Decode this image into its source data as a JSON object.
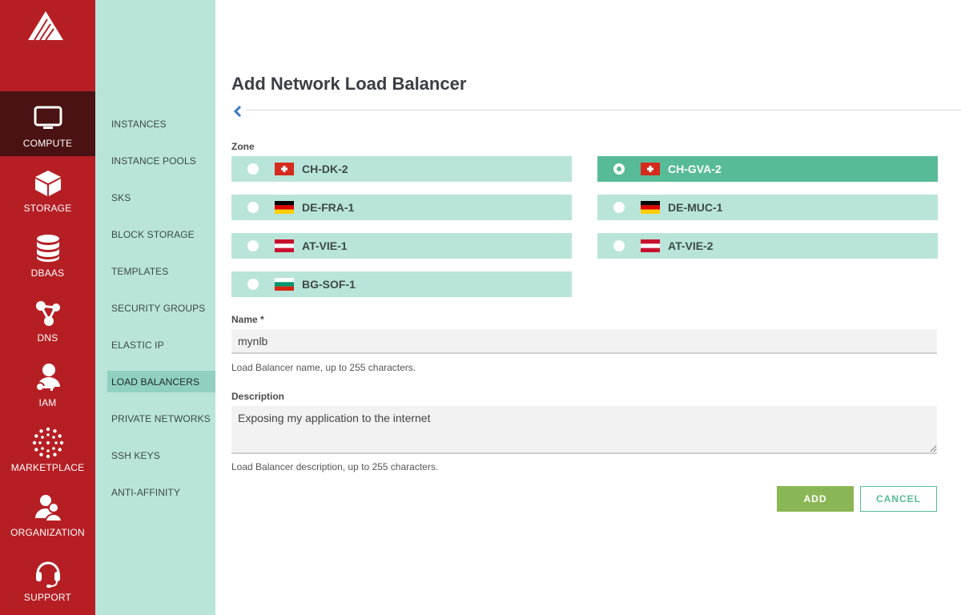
{
  "rail": {
    "logo_icon": "exoscale-logo",
    "items": [
      {
        "label": "COMPUTE",
        "icon": "monitor-icon",
        "active": true
      },
      {
        "label": "STORAGE",
        "icon": "cube-icon"
      },
      {
        "label": "DBAAS",
        "icon": "database-icon"
      },
      {
        "label": "DNS",
        "icon": "network-icon"
      },
      {
        "label": "IAM",
        "icon": "user-key-icon"
      },
      {
        "label": "MARKETPLACE",
        "icon": "dots-circle-icon"
      },
      {
        "label": "ORGANIZATION",
        "icon": "users-icon"
      },
      {
        "label": "SUPPORT",
        "icon": "headset-icon"
      }
    ]
  },
  "subnav": {
    "items": [
      {
        "label": "INSTANCES"
      },
      {
        "label": "INSTANCE POOLS"
      },
      {
        "label": "SKS"
      },
      {
        "label": "BLOCK STORAGE"
      },
      {
        "label": "TEMPLATES"
      },
      {
        "label": "SECURITY GROUPS"
      },
      {
        "label": "ELASTIC IP"
      },
      {
        "label": "LOAD BALANCERS",
        "active": true
      },
      {
        "label": "PRIVATE NETWORKS"
      },
      {
        "label": "SSH KEYS"
      },
      {
        "label": "ANTI-AFFINITY"
      }
    ]
  },
  "page": {
    "title": "Add Network Load Balancer",
    "back_icon": "chevron-left-icon"
  },
  "form": {
    "zone_label": "Zone",
    "zones": [
      {
        "name": "CH-DK-2",
        "flag": "switzerland",
        "selected": false
      },
      {
        "name": "CH-GVA-2",
        "flag": "switzerland",
        "selected": true
      },
      {
        "name": "DE-FRA-1",
        "flag": "germany",
        "selected": false
      },
      {
        "name": "DE-MUC-1",
        "flag": "germany",
        "selected": false
      },
      {
        "name": "AT-VIE-1",
        "flag": "austria",
        "selected": false
      },
      {
        "name": "AT-VIE-2",
        "flag": "austria",
        "selected": false
      },
      {
        "name": "BG-SOF-1",
        "flag": "bulgaria",
        "selected": false
      }
    ],
    "name_label": "Name *",
    "name_value": "mynlb",
    "name_help": "Load Balancer name, up to 255 characters.",
    "description_label": "Description",
    "description_value": "Exposing my application to the internet",
    "description_help": "Load Balancer description, up to 255 characters.",
    "add_label": "ADD",
    "cancel_label": "CANCEL"
  },
  "colors": {
    "rail": "#b51f24",
    "rail_active": "#4a1212",
    "subnav": "#b9e4d9",
    "zone": "#b9e4d9",
    "zone_selected": "#57bb98",
    "add_button": "#8ab755"
  }
}
